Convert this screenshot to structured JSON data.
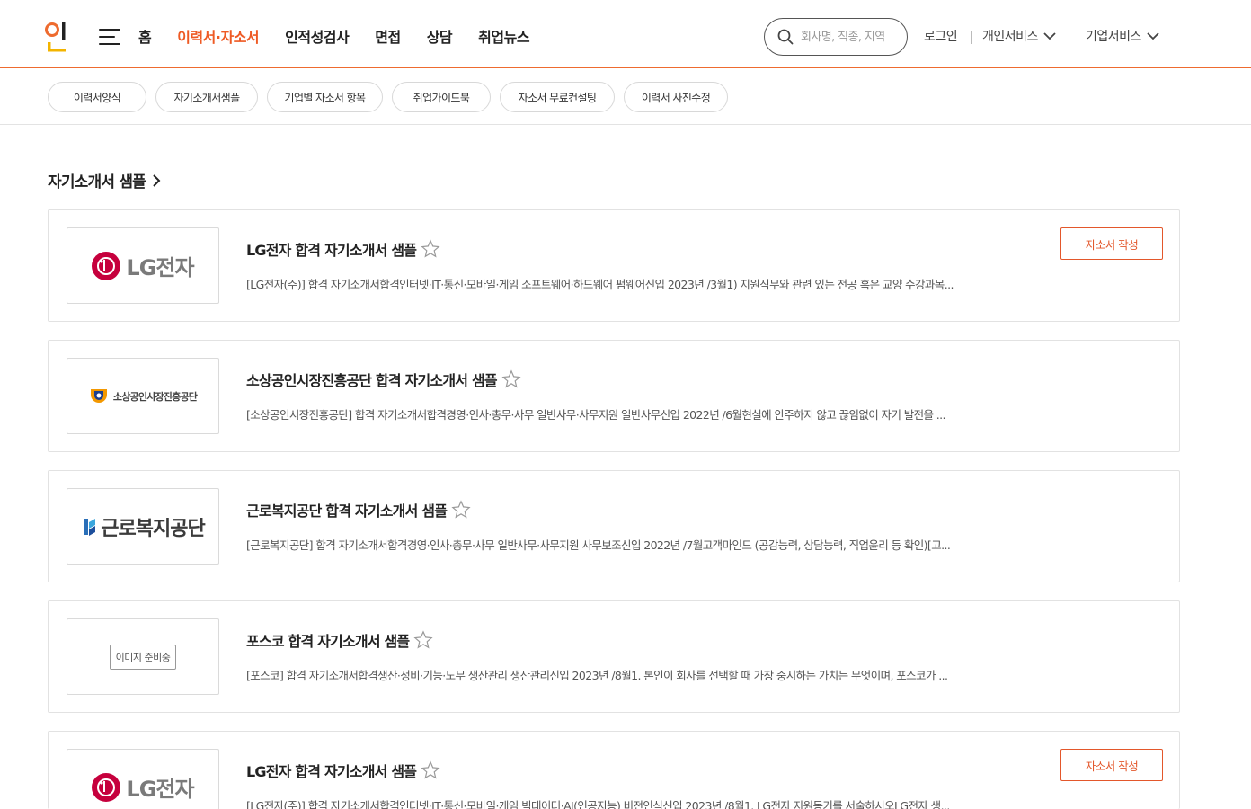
{
  "header": {
    "nav": [
      "홈",
      "이력서·자소서",
      "인적성검사",
      "면접",
      "상담",
      "취업뉴스"
    ],
    "search_placeholder": "회사명, 직종, 지역",
    "login": "로그인",
    "personal_service": "개인서비스",
    "corporate_service": "기업서비스",
    "accent_color": "#ee5a24"
  },
  "subnav": [
    "이력서양식",
    "자기소개서샘플",
    "기업별 자소서 항목",
    "취업가이드북",
    "자소서 무료컨설팅",
    "이력서 사진수정"
  ],
  "section_title": "자기소개서 샘플",
  "cards": [
    {
      "logo_type": "lg",
      "logo_text": "LG전자",
      "title": "LG전자 합격 자기소개서 샘플",
      "desc": "[LG전자(주)] 합격 자기소개서합격인터넷·IT·통신·모바일·게임 소프트웨어·하드웨어 펌웨어신입 2023년 /3월1) 지원직무와 관련 있는 전공 혹은 교양 수강과목...",
      "button": "자소서 작성"
    },
    {
      "logo_type": "semas",
      "logo_text": "소상공인시장진흥공단",
      "title": "소상공인시장진흥공단 합격 자기소개서 샘플",
      "desc": "[소상공인시장진흥공단] 합격 자기소개서합격경영·인사·총무·사무 일반사무·사무지원 일반사무신입 2022년 /6월현실에 안주하지 않고 끊임없이 자기 발전을 ...",
      "button": ""
    },
    {
      "logo_type": "kcomwel",
      "logo_text": "근로복지공단",
      "title": "근로복지공단 합격 자기소개서 샘플",
      "desc": "[근로복지공단] 합격 자기소개서합격경영·인사·총무·사무 일반사무·사무지원 사무보조신입 2022년 /7월고객마인드 (공감능력, 상담능력, 직업윤리 등 확인)[고...",
      "button": ""
    },
    {
      "logo_type": "none",
      "logo_text": "이미지 준비중",
      "title": "포스코 합격 자기소개서 샘플",
      "desc": "[포스코] 합격 자기소개서합격생산·정비·기능·노무 생산관리 생산관리신입 2023년 /8월1. 본인이 회사를 선택할 때 가장 중시하는 가치는 무엇이며, 포스코가 ...",
      "button": ""
    },
    {
      "logo_type": "lg",
      "logo_text": "LG전자",
      "title": "LG전자 합격 자기소개서 샘플",
      "desc": "[LG전자(주)] 합격 자기소개서합격인터넷·IT·통신·모바일·게임 빅데이터·AI(인공지능) 비전인식신입 2023년 /8월1. LG전자 지원동기를 서술하시오LG전자 생...",
      "button": "자소서 작성"
    }
  ]
}
